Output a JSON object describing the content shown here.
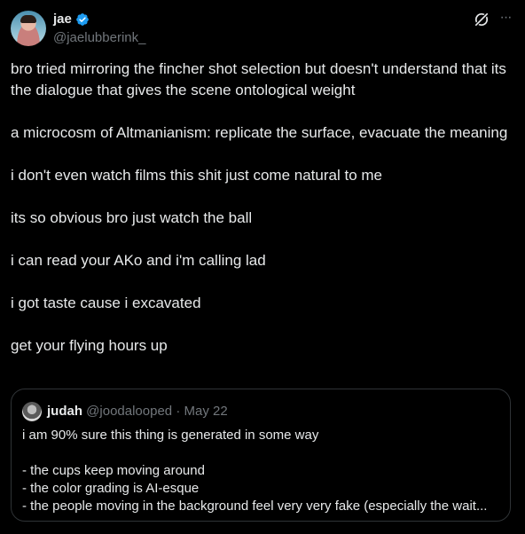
{
  "author": {
    "display_name": "jae",
    "handle": "@jaelubberink_",
    "verified": true
  },
  "actions": {
    "more_label": "···"
  },
  "tweet_lines": [
    "bro tried mirroring the fincher shot selection but doesn't understand that its the dialogue that gives the scene ontological weight",
    "a microcosm of Altmanianism: replicate the surface, evacuate the meaning",
    "i don't even watch films this shit just come natural to me",
    "its so obvious bro just watch the ball",
    "i can read your AKo and i'm calling lad",
    "i got taste cause i excavated",
    "get your flying hours up"
  ],
  "quote": {
    "display_name": "judah",
    "handle": "@joodalooped",
    "separator": "·",
    "date": "May 22",
    "intro": "i am 90% sure this thing is generated in some way",
    "bullets": [
      "- the cups keep moving around",
      "- the color grading is AI-esque",
      "- the people moving in the background feel very very fake (especially the wait..."
    ]
  },
  "colors": {
    "background": "#000000",
    "text": "#e7e9ea",
    "secondary": "#71767b",
    "verified_blue": "#1d9bf0",
    "border": "#2f3336"
  }
}
